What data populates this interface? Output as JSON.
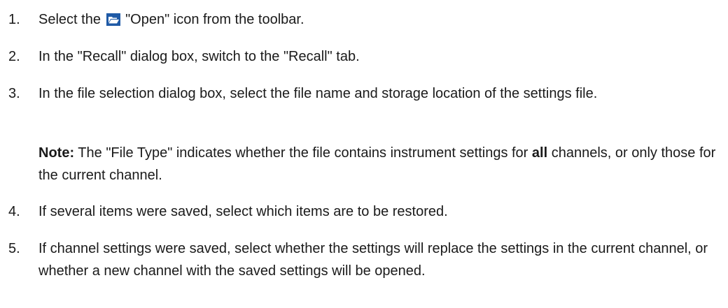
{
  "steps": [
    {
      "number": "1.",
      "text_before_icon": "Select the ",
      "icon": "open-folder-icon",
      "text_after_icon": " \"Open\" icon from the toolbar."
    },
    {
      "number": "2.",
      "text": "In the \"Recall\" dialog box, switch to the \"Recall\" tab."
    },
    {
      "number": "3.",
      "text": "In the file selection dialog box, select the file name and storage location of the settings file."
    },
    {
      "number": "4.",
      "text": "If several items were saved, select which items are to be restored."
    },
    {
      "number": "5.",
      "text": "If channel settings were saved, select whether the settings will replace the settings in the current channel, or whether a new channel with the saved settings will be opened."
    }
  ],
  "note": {
    "label": "Note:",
    "text_before_bold": " The \"File Type\" indicates whether the file contains instrument settings for ",
    "bold_word": "all",
    "text_after_bold": " channels, or only those for the current channel."
  },
  "colors": {
    "icon_background": "#1f5aa6",
    "icon_folder": "#ffffff"
  }
}
